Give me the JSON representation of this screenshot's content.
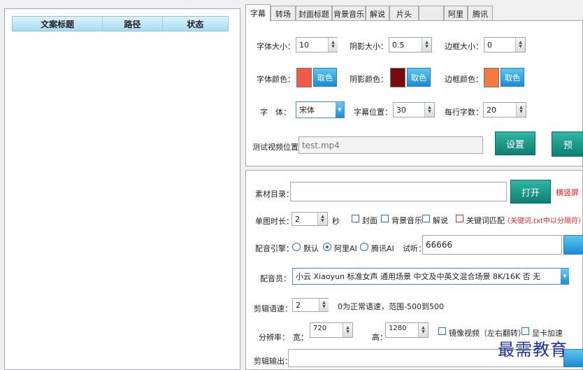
{
  "list": {
    "columns": [
      "文案标题",
      "路径",
      "状态"
    ]
  },
  "tabs": [
    "字幕",
    "转场",
    "封面标题",
    "背景音乐",
    "解说",
    "片头",
    "",
    "阿里",
    "腾讯"
  ],
  "subtitle": {
    "font_size_label": "字体大小：",
    "font_size_value": "10",
    "shadow_size_label": "阴影大小：",
    "shadow_size_value": "0.5",
    "border_size_label": "边框大小：",
    "border_size_value": "0",
    "font_color_label": "字体颜色：",
    "shadow_color_label": "阴影颜色：",
    "border_color_label": "边框颜色：",
    "pick_color_label": "取色",
    "font_color": "#f15a45",
    "shadow_color": "#7a0a0a",
    "border_color": "#f47a42",
    "font_label": "字　体：",
    "font_value": "宋体",
    "position_label": "字幕位置：",
    "position_value": "30",
    "chars_per_line_label": "每行字数：",
    "chars_per_line_value": "20",
    "test_video_label": "测试视频位置：",
    "test_video_value": "test.mp4",
    "settings_button": "设置",
    "preview_button": "预"
  },
  "material": {
    "dir_label": "素材目录：",
    "dir_value": "",
    "open_button": "打开",
    "landscape_link": "横竖屏",
    "duration_label": "单图时长：",
    "duration_value": "2",
    "seconds_unit": "秒",
    "cover_label": "封面",
    "bgm_label": "背景音乐",
    "narration_label": "解说",
    "keyword_label": "关键词匹配",
    "keyword_hint": "（关键词.txt中以分隔符）",
    "engine_label": "配音引擎：",
    "engine_default": "默认",
    "engine_ali": "阿里AI",
    "engine_tencent": "腾讯AI",
    "listen_label": "试听：",
    "listen_value": "66666",
    "voice_label": "配音员：",
    "voice_value": "小云 Xiaoyun 标准女声 通用场景 中文及中英文混合场景 8K/16K 否 无",
    "speed_label": "剪辑语速：",
    "speed_value": "2",
    "speed_hint": "0为正常语速，范围-500到500",
    "resolution_label": "分辨率：",
    "width_label": "宽：",
    "width_value": "720",
    "height_label": "高：",
    "height_value": "1280",
    "mirror_label": "镜像视频（左右翻转）",
    "gpu_label": "显卡加速",
    "output_label": "剪辑输出：",
    "output_value": ""
  },
  "watermark": "最需教育"
}
